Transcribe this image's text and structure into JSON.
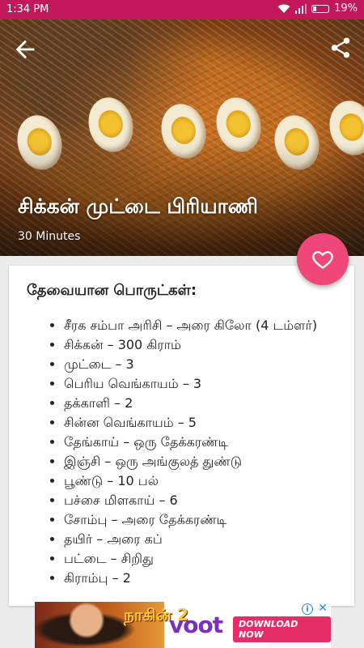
{
  "status_bar": {
    "time": "1:34 PM",
    "battery": "19%",
    "battery_level": 0.19
  },
  "recipe": {
    "title": "சிக்கன் முட்டை பிரியாணி",
    "duration": "30 Minutes"
  },
  "ingredients": {
    "heading": "தேவையான பொருட்கள்:",
    "items": [
      "சீரக சம்பா அரிசி – அரை கிலோ (4 டம்ளர்)",
      "சிக்கன் – 300 கிராம்",
      "முட்டை – 3",
      "பெரிய வெங்காயம் – 3",
      "தக்காளி – 2",
      "சின்ன வெங்காயம் – 5",
      "தேங்காய் – ஒரு தேக்கரண்டி",
      "இஞ்சி – ஒரு அங்குலத் துண்டு",
      "பூண்டு – 10 பல்",
      "பச்சை மிளகாய் – 6",
      "சோம்பு – அரை தேக்கரண்டி",
      "தயிர் – அரை கப்",
      "பட்டை – சிறிது",
      "கிராம்பு – 2"
    ]
  },
  "ad": {
    "show_text": "நாகின் 2",
    "brand": "voot",
    "cta": "DOWNLOAD NOW",
    "info_icon": "info-icon",
    "close_icon": "close-icon"
  },
  "icons": {
    "back": "back-arrow-icon",
    "share": "share-icon",
    "favorite": "heart-icon"
  },
  "colors": {
    "status_bar": "#c2185b",
    "fab": "#f0477a",
    "ad_brand": "#7b2fbe",
    "ad_cta": "#e52e68"
  }
}
